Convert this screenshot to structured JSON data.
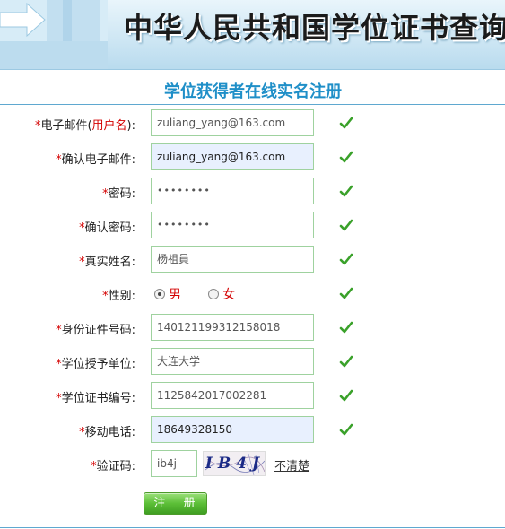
{
  "header": {
    "title": "中华人民共和国学位证书查询"
  },
  "form": {
    "title": "学位获得者在线实名注册",
    "required_mark": "*",
    "email": {
      "label": "电子邮件(",
      "label_highlight": "用户名",
      "label_suffix": "):",
      "value": "zuliang_yang@163.com"
    },
    "confirm_email": {
      "label": "确认电子邮件:",
      "value": "zuliang_yang@163.com"
    },
    "password": {
      "label": "密码:",
      "value": "••••••••"
    },
    "confirm_password": {
      "label": "确认密码:",
      "value": "••••••••"
    },
    "real_name": {
      "label": "真实姓名:",
      "value": "杨祖員"
    },
    "gender": {
      "label": "性别:",
      "options": [
        "男",
        "女"
      ],
      "selected": "男"
    },
    "id_number": {
      "label": "身份证件号码:",
      "value": "140121199312158018"
    },
    "degree_unit": {
      "label": "学位授予单位:",
      "value": "大连大学"
    },
    "certificate_number": {
      "label": "学位证书编号:",
      "value": "1125842017002281"
    },
    "mobile": {
      "label": "移动电话:",
      "value": "18649328150"
    },
    "captcha": {
      "label": "验证码:",
      "value": "ib4j",
      "image_text": "IB4J",
      "refresh_link": "不清楚"
    },
    "submit_label": "注 册"
  },
  "colors": {
    "accent": "#1f8fc8",
    "required": "#d40000",
    "check": "#3aa12a",
    "button": "#5cbf37"
  },
  "icons": {
    "valid": "check-icon",
    "banner": "arrow-right-icon"
  }
}
